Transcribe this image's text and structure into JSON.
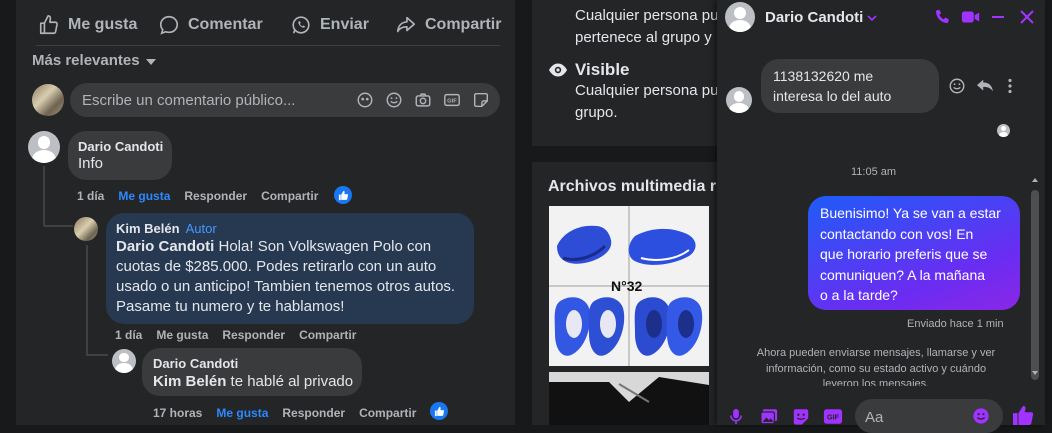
{
  "post_actions": {
    "like": "Me gusta",
    "comment": "Comentar",
    "send": "Enviar",
    "share": "Compartir"
  },
  "sort": {
    "label": "Más relevantes"
  },
  "comment_input": {
    "placeholder": "Escribe un comentario público..."
  },
  "comments": [
    {
      "name": "Dario Candoti",
      "text": "Info",
      "time": "1 día",
      "like": "Me gusta",
      "reply": "Responder",
      "share": "Compartir"
    },
    {
      "name": "Kim Belén",
      "badge": "Autor",
      "mention": "Dario Candoti",
      "text": " Hola! Son Volkswagen Polo con cuotas de $285.000. Podes retirarlo con un auto usado o un anticipo! Tambien tenemos otros autos. Pasame tu numero y te hablamos!",
      "line1_rest": " Hola! Son Volkswagen Polo con",
      "line2": "cuotas de $285.000. Podes retirarlo con un auto",
      "line3": "usado o un anticipo! Tambien tenemos otros autos.",
      "line4": "Pasame tu numero y te hablamos!",
      "time": "1 día",
      "like": "Me gusta",
      "reply": "Responder",
      "share": "Compartir"
    },
    {
      "name": "Dario Candoti",
      "mention": "Kim Belén",
      "text_rest": " te hablé al privado",
      "time": "17 horas",
      "like": "Me gusta",
      "reply": "Responder",
      "share": "Compartir"
    }
  ],
  "group_info": {
    "private_line1": "Cualquier persona pu",
    "private_line2": "pertenece al grupo y",
    "visible_title": "Visible",
    "visible_line1": "Cualquier persona pu",
    "visible_line2": "grupo."
  },
  "media": {
    "title": "Archivos multimedia r",
    "photo_label": "N°32"
  },
  "chat": {
    "contact": "Dario Candoti",
    "incoming": {
      "line1": "1138132620 me",
      "line2": "interesa lo del auto"
    },
    "time_divider": "11:05 am",
    "outgoing": {
      "lines": [
        "Buenisimo! Ya se van a estar",
        "contactando con vos! En",
        "que horario preferis que se",
        "comuniquen? A la mañana",
        "o a la tarde?"
      ]
    },
    "sent_status": "Enviado hace 1 min",
    "notice": {
      "line1": "Ahora pueden enviarse mensajes, llamarse y ver",
      "line2": "información, como su estado activo y cuándo",
      "line3": "leyeron los mensajes."
    },
    "input_placeholder": "Aa"
  },
  "colors": {
    "accent": "#2d88ff",
    "author_badge": "#4599ff",
    "chat_icons": "#a033ff",
    "background": "#18191a",
    "card": "#242526"
  }
}
